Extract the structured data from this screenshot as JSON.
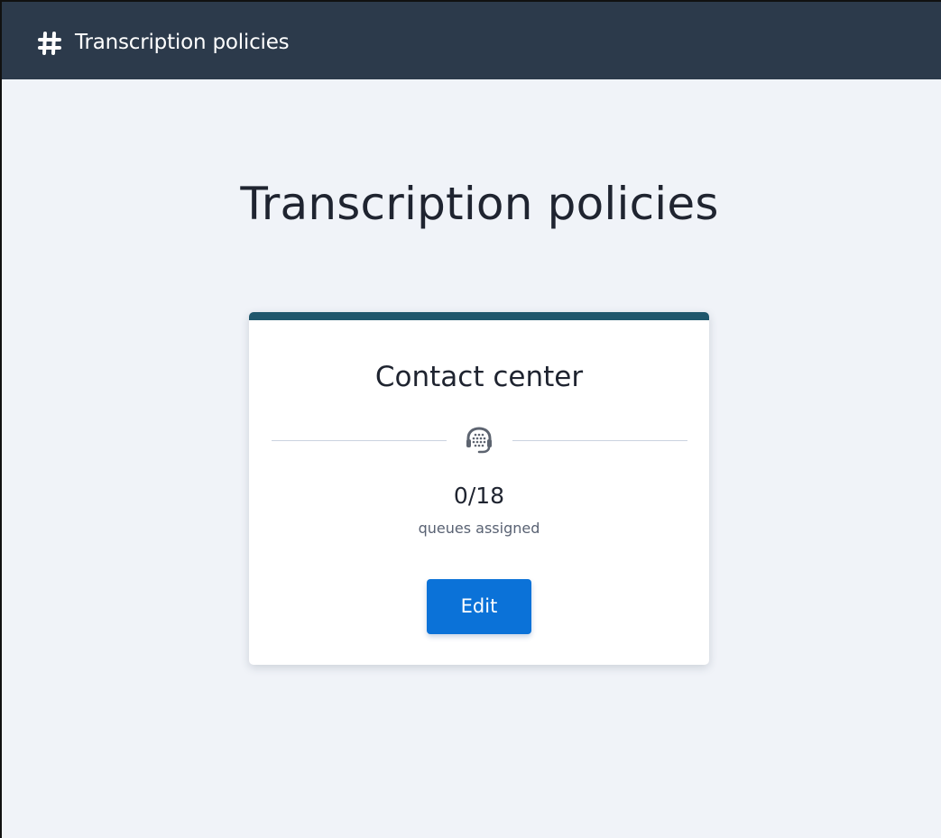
{
  "header": {
    "icon": "hash-icon",
    "title": "Transcription policies",
    "background_color": "#2c3a4b"
  },
  "page": {
    "title": "Transcription policies",
    "background_color": "#f0f3f8"
  },
  "policy_card": {
    "accent_color": "#20576c",
    "title": "Contact center",
    "icon": "headset-icon",
    "count": "0/18",
    "count_label": "queues assigned",
    "edit_label": "Edit",
    "button_color": "#0b72d8"
  }
}
